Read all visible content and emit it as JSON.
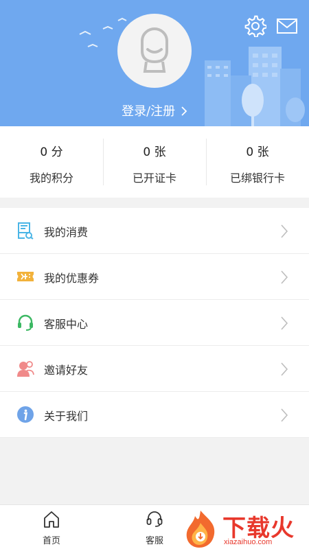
{
  "header": {
    "login_label": "登录/注册",
    "icons": {
      "settings": "gear-icon",
      "mail": "mail-icon",
      "avatar": "avatar-placeholder-icon"
    },
    "colors": {
      "background": "#6fa8ef",
      "accent": "#ffffff"
    }
  },
  "stats": [
    {
      "value": "0 分",
      "label": "我的积分"
    },
    {
      "value": "0 张",
      "label": "已开证卡"
    },
    {
      "value": "0 张",
      "label": "已绑银行卡"
    }
  ],
  "menu": {
    "items": [
      {
        "label": "我的消费",
        "icon": "receipt-icon"
      },
      {
        "label": "我的优惠券",
        "icon": "coupon-icon"
      },
      {
        "label": "客服中心",
        "icon": "headset-icon"
      },
      {
        "label": "邀请好友",
        "icon": "invite-friend-icon"
      },
      {
        "label": "关于我们",
        "icon": "info-icon"
      }
    ]
  },
  "tabbar": {
    "items": [
      {
        "label": "首页",
        "icon": "home-icon"
      },
      {
        "label": "客服",
        "icon": "headset-icon"
      }
    ]
  },
  "watermark": {
    "title": "下载火",
    "subtitle": "xiazaihuo.com"
  }
}
